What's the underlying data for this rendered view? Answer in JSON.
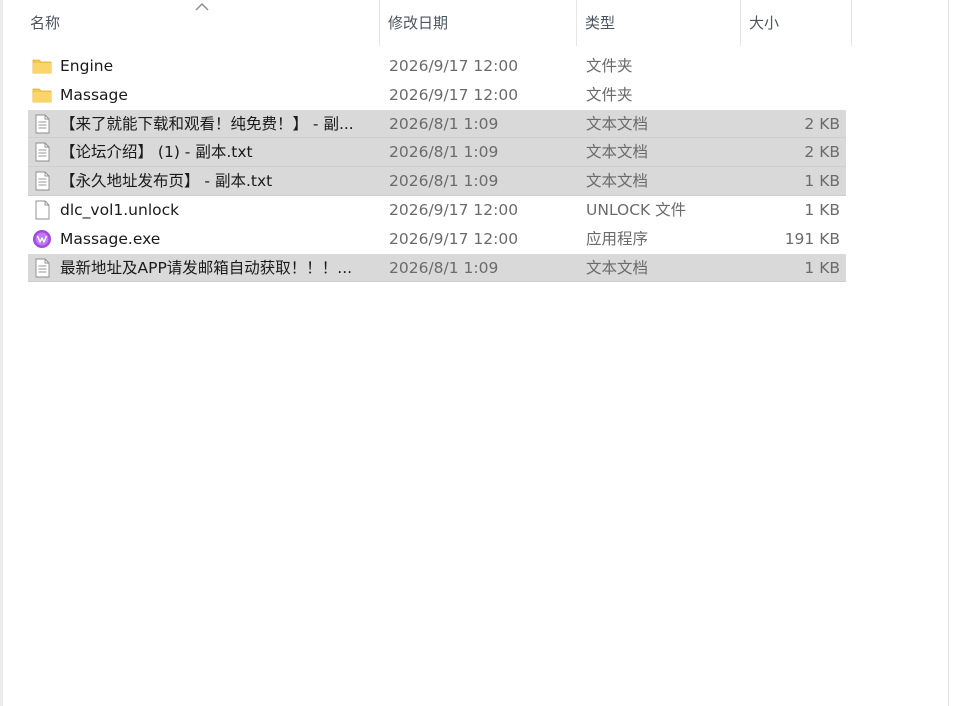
{
  "columns": {
    "name": "名称",
    "date": "修改日期",
    "type": "类型",
    "size": "大小"
  },
  "files": [
    {
      "name": "Engine",
      "date": "2026/9/17 12:00",
      "type": "文件夹",
      "size": "",
      "icon": "folder-icon",
      "selected": false
    },
    {
      "name": "Massage",
      "date": "2026/9/17 12:00",
      "type": "文件夹",
      "size": "",
      "icon": "folder-icon",
      "selected": false
    },
    {
      "name": "【来了就能下载和观看！纯免费！】 - 副...",
      "date": "2026/8/1 1:09",
      "type": "文本文档",
      "size": "2 KB",
      "icon": "text-document-icon",
      "selected": true
    },
    {
      "name": "【论坛介绍】 (1) - 副本.txt",
      "date": "2026/8/1 1:09",
      "type": "文本文档",
      "size": "2 KB",
      "icon": "text-document-icon",
      "selected": true
    },
    {
      "name": "【永久地址发布页】 - 副本.txt",
      "date": "2026/8/1 1:09",
      "type": "文本文档",
      "size": "1 KB",
      "icon": "text-document-icon",
      "selected": true
    },
    {
      "name": "dlc_vol1.unlock",
      "date": "2026/9/17 12:00",
      "type": "UNLOCK 文件",
      "size": "1 KB",
      "icon": "blank-file-icon",
      "selected": false
    },
    {
      "name": "Massage.exe",
      "date": "2026/9/17 12:00",
      "type": "应用程序",
      "size": "191 KB",
      "icon": "app-icon",
      "selected": false
    },
    {
      "name": "最新地址及APP请发邮箱自动获取！！！...",
      "date": "2026/8/1 1:09",
      "type": "文本文档",
      "size": "1 KB",
      "icon": "text-document-icon",
      "selected": true
    }
  ],
  "colors": {
    "selection": "#d9d9d9",
    "folder": "#f6c94a",
    "app": "#a04be0"
  }
}
